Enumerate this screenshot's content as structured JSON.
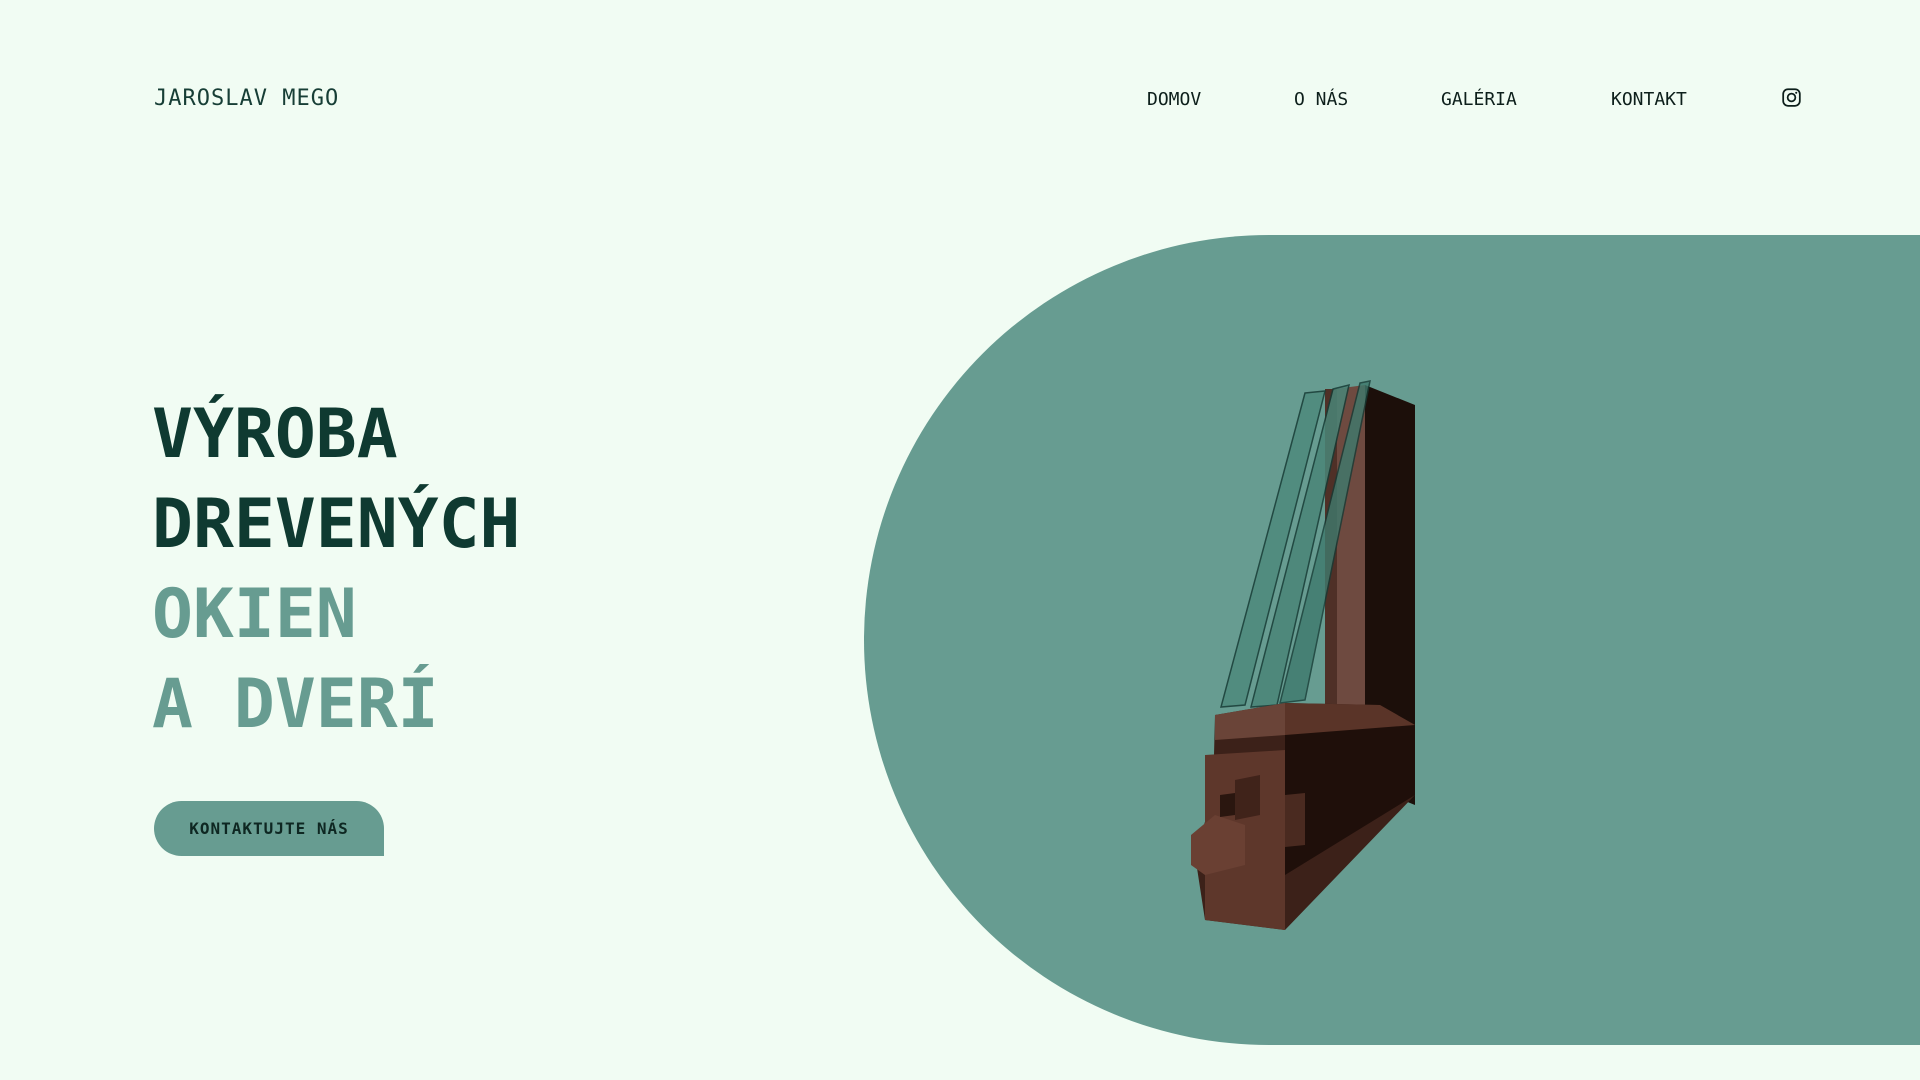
{
  "header": {
    "brand": "JAROSLAV MEGO",
    "nav": [
      {
        "label": "DOMOV"
      },
      {
        "label": "O NÁS"
      },
      {
        "label": "GALÉRIA"
      },
      {
        "label": "KONTAKT"
      }
    ],
    "social_icon": "instagram-icon"
  },
  "hero": {
    "line1": "VÝROBA",
    "line2": "DREVENÝCH",
    "line3": "OKIEN",
    "line4": "A DVERÍ",
    "cta_label": "KONTAKTUJTE NÁS"
  },
  "colors": {
    "background": "#f1fcf3",
    "accent": "#679c91",
    "dark_text": "#0f3a31",
    "wood": "#5a3428"
  },
  "image": {
    "subject": "wooden-window-profile-illustration"
  }
}
